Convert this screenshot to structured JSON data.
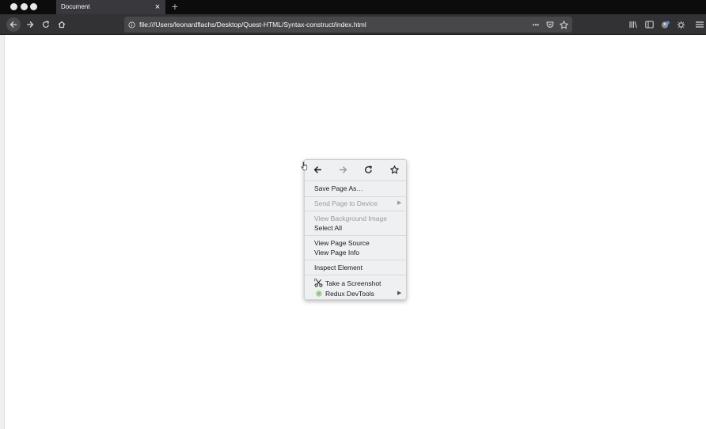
{
  "browser": {
    "tab_title": "Document",
    "tab_close": "×",
    "new_tab": "+",
    "url": "file:///Users/leonardflachs/Desktop/Quest-HTML/Syntax-construct/index.html",
    "page_actions": "•••"
  },
  "context_menu": {
    "items": {
      "save_page_as": "Save Page As…",
      "send_page_to_device": "Send Page to Device",
      "view_background_image": "View Background Image",
      "select_all": "Select All",
      "view_page_source": "View Page Source",
      "view_page_info": "View Page Info",
      "inspect_element": "Inspect Element",
      "take_a_screenshot": "Take a Screenshot",
      "redux_devtools": "Redux DevTools"
    },
    "submenu_arrow": "▶"
  },
  "colors": {
    "tabbar": "#0c0c0d",
    "toolbar": "#323234",
    "urlbar": "#474749",
    "menu_bg": "#eef0f2",
    "disabled_text": "#9a9a9e"
  }
}
